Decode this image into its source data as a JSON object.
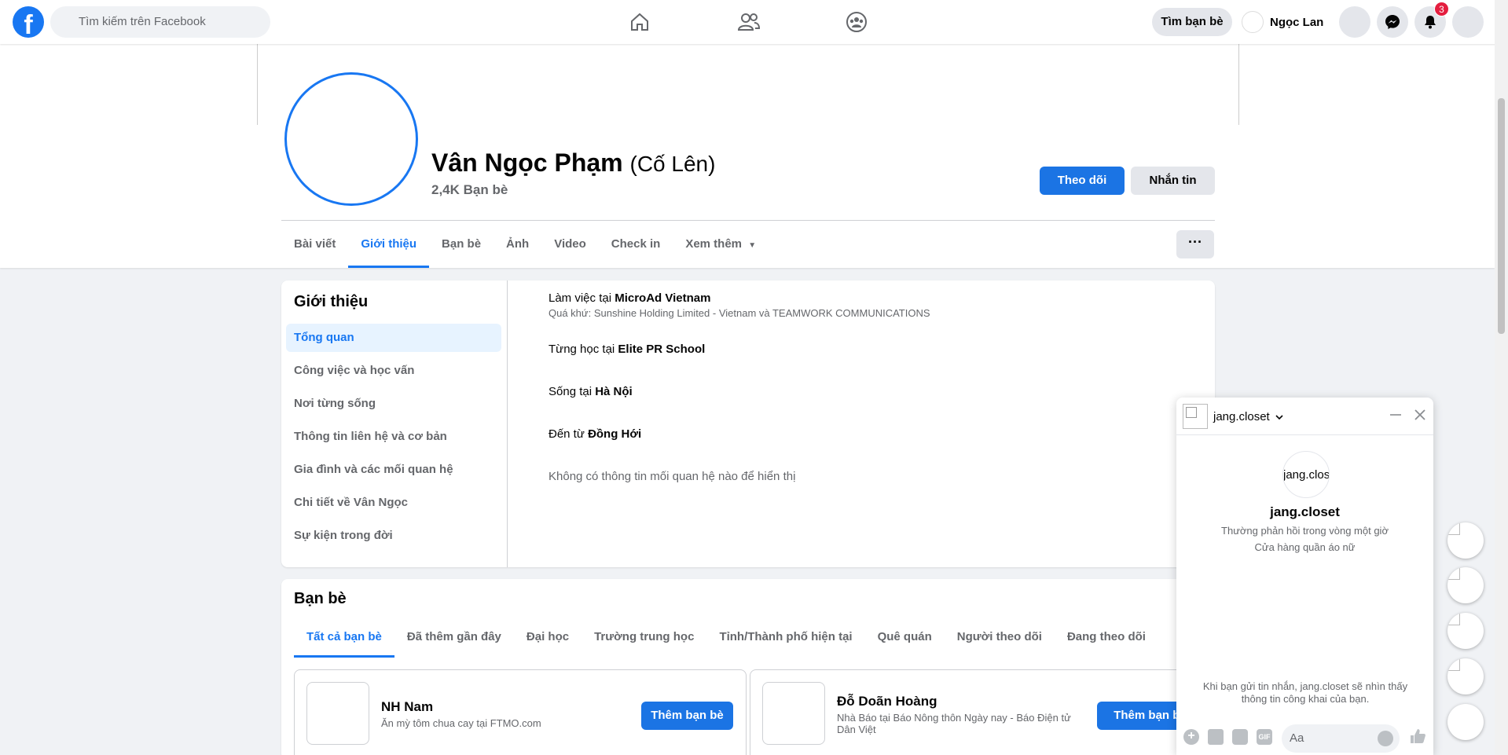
{
  "topbar": {
    "logo_letter": "f",
    "search_placeholder": "Tìm kiếm trên Facebook",
    "find_friends": "Tìm bạn bè",
    "user_name": "Ngọc Lan",
    "notification_count": "3",
    "icons": [
      "home-icon",
      "friends-icon",
      "groups-icon",
      "messenger-icon",
      "bell-icon"
    ]
  },
  "profile": {
    "name": "Vân Ngọc Phạm",
    "alt_name": "(Cố Lên)",
    "friends_count": "2,4K Bạn bè",
    "follow_label": "Theo dõi",
    "message_label": "Nhắn tin"
  },
  "tabs": [
    "Bài viết",
    "Giới thiệu",
    "Bạn bè",
    "Ảnh",
    "Video",
    "Check in",
    "Xem thêm"
  ],
  "more_label": "···",
  "about": {
    "title": "Giới thiệu",
    "nav": [
      "Tổng quan",
      "Công việc và học vấn",
      "Nơi từng sống",
      "Thông tin liên hệ và cơ bản",
      "Gia đình và các mối quan hệ",
      "Chi tiết về Vân Ngọc",
      "Sự kiện trong đời"
    ],
    "work_prefix": "Làm việc tại ",
    "work_place": "MicroAd Vietnam",
    "work_past": "Quá khứ: Sunshine Holding Limited - Vietnam và TEAMWORK COMMUNICATIONS",
    "study_prefix": "Từng học tại ",
    "study_place": "Elite PR School",
    "live_prefix": "Sống tại ",
    "live_place": "Hà Nội",
    "from_prefix": "Đến từ ",
    "from_place": "Đồng Hới",
    "relationship": "Không có thông tin mối quan hệ nào để hiển thị"
  },
  "friends": {
    "title": "Bạn bè",
    "tabs": [
      "Tất cả bạn bè",
      "Đã thêm gần đây",
      "Đại học",
      "Trường trung học",
      "Tỉnh/Thành phố hiện tại",
      "Quê quán",
      "Người theo dõi",
      "Đang theo dõi"
    ],
    "items": [
      {
        "name": "NH Nam",
        "desc": "Ăn mỳ tôm chua cay tại FTMO.com",
        "button": "Thêm bạn bè"
      },
      {
        "name": "Đỗ Doãn Hoàng",
        "desc": "Nhà Báo tại Báo Nông thôn Ngày nay - Báo Điện tử Dân Việt",
        "button": "Thêm bạn bè"
      }
    ]
  },
  "chat": {
    "title": "jang.closet",
    "avatar_text": "jang.clos",
    "name": "jang.closet",
    "response": "Thường phản hồi trong vòng một giờ",
    "category": "Cửa hàng quần áo nữ",
    "notice": "Khi bạn gửi tin nhắn, jang.closet sẽ nhìn thấy thông tin công khai của bạn.",
    "input_placeholder": "Aa",
    "gif_label": "GIF"
  }
}
